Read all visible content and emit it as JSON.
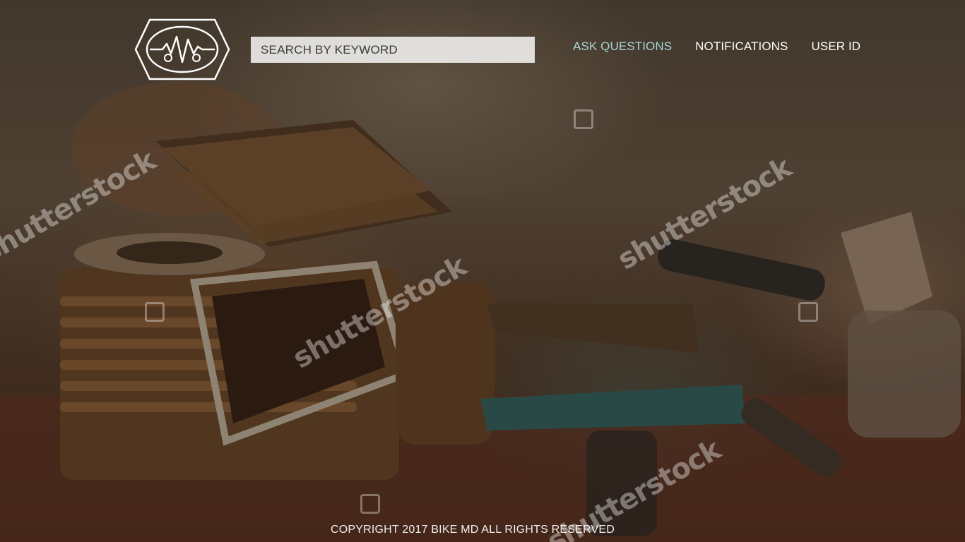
{
  "header": {
    "logo_icon": "heartbeat-hexagon-logo",
    "search": {
      "placeholder": "SEARCH BY KEYWORD",
      "value": ""
    },
    "nav": {
      "ask_questions": "ASK QUESTIONS",
      "notifications": "NOTIFICATIONS",
      "user_id": "USER ID"
    }
  },
  "watermark": {
    "text": "shutterstock"
  },
  "footer": {
    "copyright": "COPYRIGHT 2017 BIKE MD ALL RIGHTS RESERVED"
  },
  "colors": {
    "nav_accent": "#a9d4d6",
    "nav_text": "#ffffff",
    "search_bg": "#ffffffd1"
  }
}
